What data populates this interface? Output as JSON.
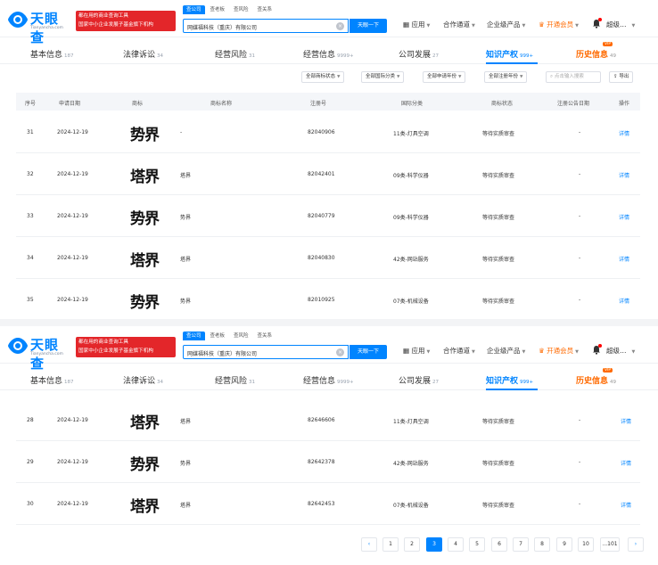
{
  "brand": {
    "name": "天眼查",
    "domain": "Tianyancha.com",
    "promo_line1": "都在用的商业查询工具",
    "promo_line2": "国家中小企业发展子基金旗下机构"
  },
  "search": {
    "tabs": [
      "查公司",
      "查老板",
      "查风险",
      "查关系"
    ],
    "value": "网媒福科技（重庆）有限公司",
    "button_label": "天眼一下"
  },
  "nav": {
    "app": "应用",
    "cooperate": "合作通道",
    "enterprise": "企业级产品",
    "vip": "开通会员",
    "user": "超级…"
  },
  "company_tabs": [
    {
      "label": "基本信息",
      "count": "187"
    },
    {
      "label": "法律诉讼",
      "count": "34"
    },
    {
      "label": "经营风险",
      "count": "31"
    },
    {
      "label": "经营信息",
      "count": "9999+"
    },
    {
      "label": "公司发展",
      "count": "27"
    },
    {
      "label": "知识产权",
      "count": "999+"
    },
    {
      "label": "历史信息",
      "count": "49",
      "badge": "VIP"
    }
  ],
  "filters": {
    "status": "全部商标状态",
    "category": "全部国际分类",
    "year": "全部申请年份",
    "annual": "全部注册年份",
    "search_placeholder": "点击输入搜索",
    "export": "导出"
  },
  "table": {
    "headers": [
      "序号",
      "申请日期",
      "商标",
      "商标名称",
      "注册号",
      "国际分类",
      "商标状态",
      "注册公告日期",
      "操作"
    ],
    "top_rows": [
      {
        "idx": "31",
        "date": "2024-12-19",
        "mark": "势界",
        "name": "-",
        "reg": "82040906",
        "cls": "11类-灯具空调",
        "status": "等待实质审查",
        "notice": "-",
        "action": "详情"
      },
      {
        "idx": "32",
        "date": "2024-12-19",
        "mark": "塔界",
        "name": "塔界",
        "reg": "82042401",
        "cls": "09类-科学仪器",
        "status": "等待实质审查",
        "notice": "-",
        "action": "详情"
      },
      {
        "idx": "33",
        "date": "2024-12-19",
        "mark": "势界",
        "name": "势界",
        "reg": "82040779",
        "cls": "09类-科学仪器",
        "status": "等待实质审查",
        "notice": "-",
        "action": "详情"
      },
      {
        "idx": "34",
        "date": "2024-12-19",
        "mark": "塔界",
        "name": "塔界",
        "reg": "82040830",
        "cls": "42类-网站服务",
        "status": "等待实质审查",
        "notice": "-",
        "action": "详情"
      },
      {
        "idx": "35",
        "date": "2024-12-19",
        "mark": "势界",
        "name": "势界",
        "reg": "82010925",
        "cls": "07类-机械设备",
        "status": "等待实质审查",
        "notice": "-",
        "action": "详情"
      }
    ],
    "bottom_rows": [
      {
        "idx": "28",
        "date": "2024-12-19",
        "mark": "塔界",
        "name": "塔界",
        "reg": "82646606",
        "cls": "11类-灯具空调",
        "status": "等待实质审查",
        "notice": "-",
        "action": "详情"
      },
      {
        "idx": "29",
        "date": "2024-12-19",
        "mark": "势界",
        "name": "势界",
        "reg": "82642378",
        "cls": "42类-网站服务",
        "status": "等待实质审查",
        "notice": "-",
        "action": "详情"
      },
      {
        "idx": "30",
        "date": "2024-12-19",
        "mark": "塔界",
        "name": "塔界",
        "reg": "82642453",
        "cls": "07类-机械设备",
        "status": "等待实质审查",
        "notice": "-",
        "action": "详情"
      }
    ]
  },
  "pagination": {
    "pages": [
      "1",
      "2",
      "3",
      "4",
      "5",
      "6",
      "7",
      "8",
      "9",
      "10",
      "...101"
    ],
    "current": "3",
    "prev": "‹",
    "next": "›"
  },
  "colors": {
    "accent": "#0084ff",
    "vip": "#ff6a00",
    "promo": "#e3262a"
  },
  "icons": {
    "logo": "eye-logo-icon",
    "app": "grid-icon",
    "bell": "bell-icon",
    "crown": "crown-icon",
    "export": "export-icon",
    "search": "search-icon"
  }
}
